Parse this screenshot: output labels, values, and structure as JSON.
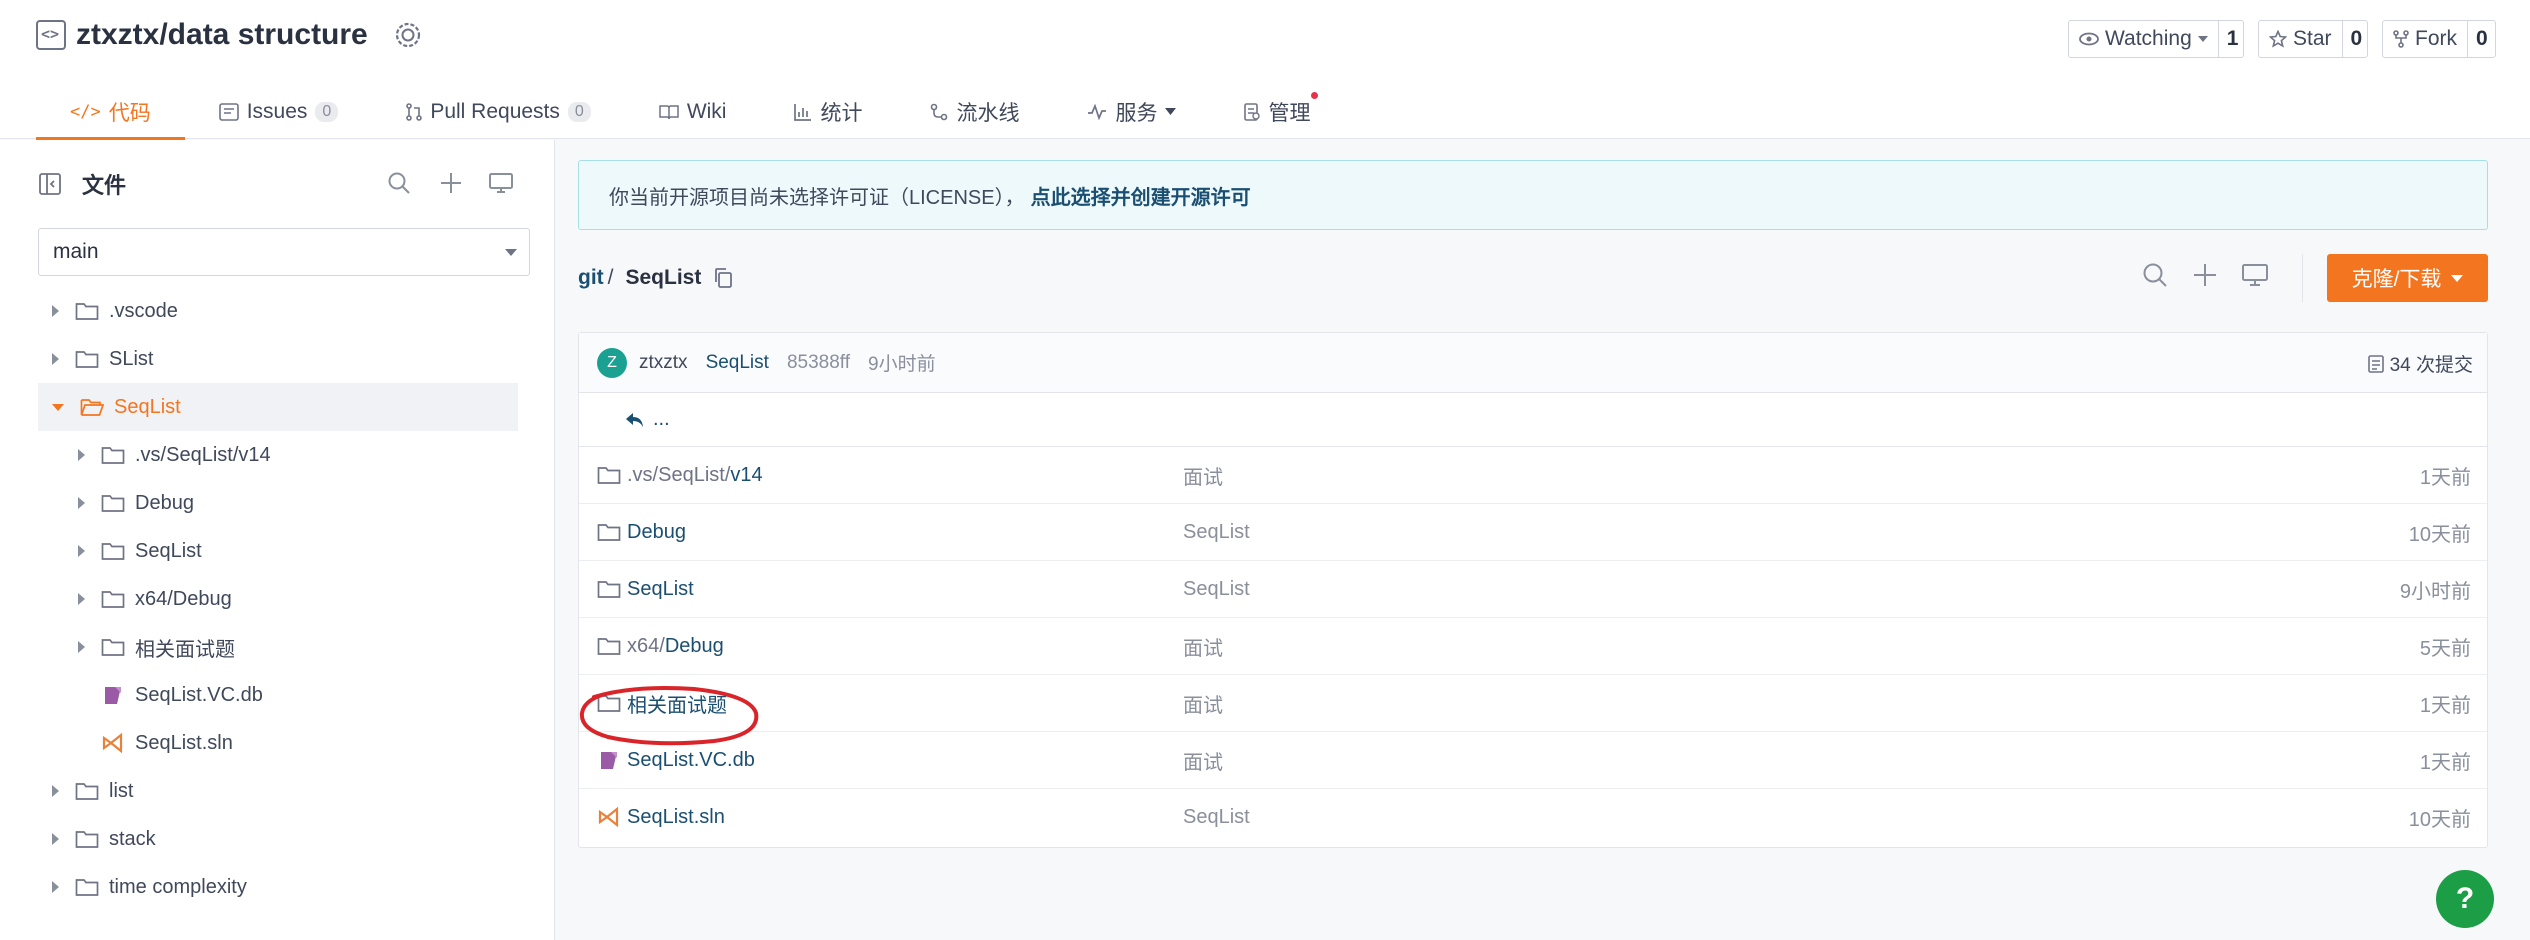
{
  "repo": {
    "title": "ztxztx/data structure"
  },
  "header_buttons": {
    "watch": {
      "label": "Watching",
      "count": "1"
    },
    "star": {
      "label": "Star",
      "count": "0"
    },
    "fork": {
      "label": "Fork",
      "count": "0"
    }
  },
  "tabs": [
    {
      "label": "代码",
      "icon": "code-icon"
    },
    {
      "label": "Issues",
      "count": "0",
      "icon": "issues-icon"
    },
    {
      "label": "Pull Requests",
      "count": "0",
      "icon": "pull-request-icon"
    },
    {
      "label": "Wiki",
      "icon": "wiki-icon"
    },
    {
      "label": "统计",
      "icon": "stats-icon"
    },
    {
      "label": "流水线",
      "icon": "pipeline-icon"
    },
    {
      "label": "服务",
      "icon": "service-icon"
    },
    {
      "label": "管理",
      "icon": "manage-icon"
    }
  ],
  "sidebar": {
    "title": "文件",
    "branch": "main",
    "tree": [
      {
        "label": ".vscode",
        "type": "folder"
      },
      {
        "label": "SList",
        "type": "folder"
      },
      {
        "label": "SeqList",
        "type": "folder"
      },
      {
        "label": ".vs/SeqList/v14",
        "type": "folder"
      },
      {
        "label": "Debug",
        "type": "folder"
      },
      {
        "label": "SeqList",
        "type": "folder"
      },
      {
        "label": "x64/Debug",
        "type": "folder"
      },
      {
        "label": "相关面试题",
        "type": "folder"
      },
      {
        "label": "SeqList.VC.db",
        "type": "db"
      },
      {
        "label": "SeqList.sln",
        "type": "sln"
      },
      {
        "label": "list",
        "type": "folder"
      },
      {
        "label": "stack",
        "type": "folder"
      },
      {
        "label": "time complexity",
        "type": "folder"
      }
    ]
  },
  "license_notice": {
    "text": "你当前开源项目尚未选择许可证（LICENSE），",
    "link": "点此选择并创建开源许可"
  },
  "breadcrumb": {
    "root": "git",
    "sep": "/",
    "current": "SeqList"
  },
  "clone_button": "克隆/下载",
  "commit": {
    "avatar": "Z",
    "author": "ztxztx",
    "message": "SeqList",
    "sha": "85388ff",
    "time": "9小时前",
    "count": "34 次提交"
  },
  "back_link": "...",
  "files": [
    {
      "prefix": ".vs/SeqList/",
      "name": "v14",
      "message": "面试",
      "time": "1天前",
      "type": "folder"
    },
    {
      "prefix": "",
      "name": "Debug",
      "message": "SeqList",
      "time": "10天前",
      "type": "folder"
    },
    {
      "prefix": "",
      "name": "SeqList",
      "message": "SeqList",
      "time": "9小时前",
      "type": "folder"
    },
    {
      "prefix": "x64/",
      "name": "Debug",
      "message": "面试",
      "time": "5天前",
      "type": "folder"
    },
    {
      "prefix": "",
      "name": "相关面试题",
      "message": "面试",
      "time": "1天前",
      "type": "folder"
    },
    {
      "prefix": "",
      "name": "SeqList.VC.db",
      "message": "面试",
      "time": "1天前",
      "type": "db"
    },
    {
      "prefix": "",
      "name": "SeqList.sln",
      "message": "SeqList",
      "time": "10天前",
      "type": "sln"
    }
  ],
  "help_button": "?",
  "colors": {
    "accent": "#f4751f",
    "link": "#1b4f72",
    "help": "#1c9e47",
    "annotation": "#d9252a"
  }
}
